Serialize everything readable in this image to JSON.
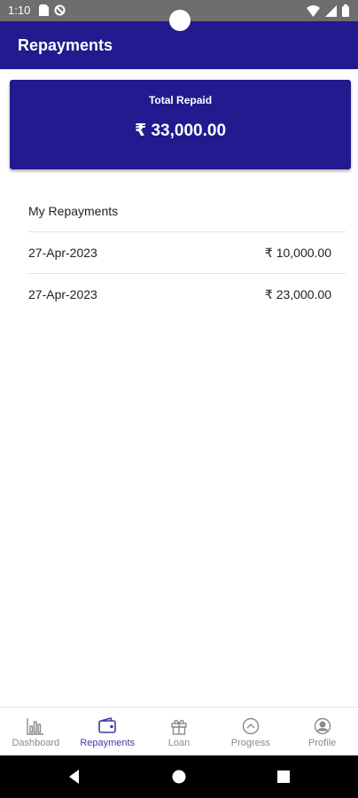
{
  "status_bar": {
    "time": "1:10",
    "icons": [
      "sim-card-icon",
      "no-disturb-icon",
      "wifi-icon",
      "signal-icon",
      "battery-icon"
    ]
  },
  "app_bar": {
    "title": "Repayments"
  },
  "summary": {
    "label": "Total Repaid",
    "value": "₹ 33,000.00"
  },
  "repayments": {
    "title": "My Repayments",
    "rows": [
      {
        "date": "27-Apr-2023",
        "amount": "₹ 10,000.00"
      },
      {
        "date": "27-Apr-2023",
        "amount": "₹ 23,000.00"
      }
    ]
  },
  "bottom_nav": {
    "items": [
      {
        "label": "Dashboard",
        "icon": "bar-chart-icon",
        "active": false
      },
      {
        "label": "Repayments",
        "icon": "wallet-icon",
        "active": true
      },
      {
        "label": "Loan",
        "icon": "gift-icon",
        "active": false
      },
      {
        "label": "Progress",
        "icon": "chevron-up-circle-icon",
        "active": false
      },
      {
        "label": "Profile",
        "icon": "user-circle-icon",
        "active": false
      }
    ]
  },
  "colors": {
    "primary": "#221a8e",
    "active_nav": "#3d3aa0",
    "inactive_nav": "#8a8a8a",
    "status_bar": "#6e6e6e"
  }
}
